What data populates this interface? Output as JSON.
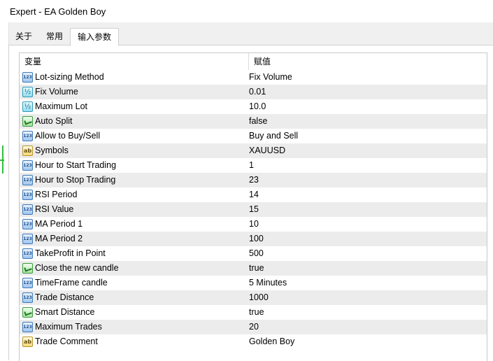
{
  "window": {
    "title": "Expert - EA Golden Boy"
  },
  "tabs": [
    {
      "label": "关于",
      "active": false
    },
    {
      "label": "常用",
      "active": false
    },
    {
      "label": "输入参数",
      "active": true
    }
  ],
  "grid": {
    "headers": {
      "variable": "变量",
      "value": "赋值"
    },
    "rows": [
      {
        "name": "Lot-sizing Method",
        "value": "Fix Volume",
        "icon": "integer-icon",
        "type": "int"
      },
      {
        "name": "Fix Volume",
        "value": "0.01",
        "icon": "double-icon",
        "type": "dbl"
      },
      {
        "name": "Maximum Lot",
        "value": "10.0",
        "icon": "double-icon",
        "type": "dbl"
      },
      {
        "name": "Auto Split",
        "value": "false",
        "icon": "boolean-icon",
        "type": "bool"
      },
      {
        "name": "Allow to Buy/Sell",
        "value": "Buy and Sell",
        "icon": "integer-icon",
        "type": "int"
      },
      {
        "name": "Symbols",
        "value": "XAUUSD",
        "icon": "string-icon",
        "type": "str"
      },
      {
        "name": "Hour to Start Trading",
        "value": "1",
        "icon": "integer-icon",
        "type": "int"
      },
      {
        "name": "Hour to Stop Trading",
        "value": "23",
        "icon": "integer-icon",
        "type": "int"
      },
      {
        "name": "RSI Period",
        "value": "14",
        "icon": "integer-icon",
        "type": "int"
      },
      {
        "name": "RSI Value",
        "value": "15",
        "icon": "integer-icon",
        "type": "int"
      },
      {
        "name": "MA Period 1",
        "value": "10",
        "icon": "integer-icon",
        "type": "int"
      },
      {
        "name": "MA Period 2",
        "value": "100",
        "icon": "integer-icon",
        "type": "int"
      },
      {
        "name": "TakeProfit in Point",
        "value": "500",
        "icon": "integer-icon",
        "type": "int"
      },
      {
        "name": "Close the new candle",
        "value": "true",
        "icon": "boolean-icon",
        "type": "bool"
      },
      {
        "name": "TimeFrame candle",
        "value": "5 Minutes",
        "icon": "integer-icon",
        "type": "int"
      },
      {
        "name": "Trade Distance",
        "value": "1000",
        "icon": "integer-icon",
        "type": "int"
      },
      {
        "name": "Smart Distance",
        "value": "true",
        "icon": "boolean-icon",
        "type": "bool"
      },
      {
        "name": "Maximum Trades",
        "value": "20",
        "icon": "integer-icon",
        "type": "int"
      },
      {
        "name": "Trade Comment",
        "value": "Golden Boy",
        "icon": "string-icon",
        "type": "str"
      }
    ]
  }
}
